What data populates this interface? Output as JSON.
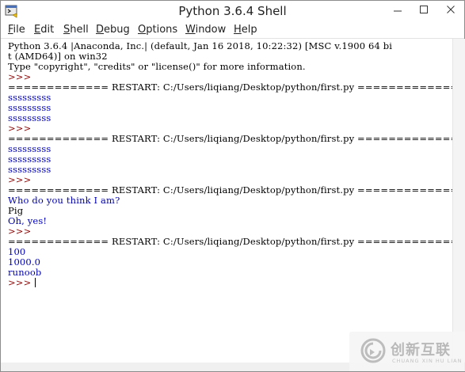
{
  "window": {
    "title": "Python 3.6.4 Shell"
  },
  "menu": [
    {
      "label": "File",
      "key": "F"
    },
    {
      "label": "Edit",
      "key": "E"
    },
    {
      "label": "Shell",
      "key": "S"
    },
    {
      "label": "Debug",
      "key": "D"
    },
    {
      "label": "Options",
      "key": "O"
    },
    {
      "label": "Window",
      "key": "W"
    },
    {
      "label": "Help",
      "key": "H"
    }
  ],
  "shell": {
    "lines": [
      "Python 3.6.4 |Anaconda, Inc.| (default, Jan 16 2018, 10:22:32) [MSC v.1900 64 bi",
      "t (AMD64)] on win32",
      "Type \"copyright\", \"credits\" or \"license()\" for more information.",
      ">>> ",
      "============= RESTART: C:/Users/liqiang/Desktop/python/first.py =============",
      "sssssssss",
      "sssssssss",
      "sssssssss",
      ">>> ",
      "============= RESTART: C:/Users/liqiang/Desktop/python/first.py =============",
      "sssssssss",
      "sssssssss",
      "sssssssss",
      ">>> ",
      "============= RESTART: C:/Users/liqiang/Desktop/python/first.py =============",
      "Who do you think I am?",
      "Pig",
      "Oh, yes!",
      ">>> ",
      "============= RESTART: C:/Users/liqiang/Desktop/python/first.py =============",
      "100",
      "1000.0",
      "runoob",
      ">>> "
    ]
  },
  "watermark": {
    "brand": "创新互联",
    "sub": "CHUANG XIN HU LIAN"
  },
  "colors": {
    "stdout": "#0000b4",
    "prompt": "#8b0000",
    "banner": "#000000",
    "input": "#000000"
  },
  "icons": {
    "app": "python-idle-icon",
    "minimize": "minimize-icon",
    "maximize": "maximize-icon",
    "close": "close-icon",
    "watermark": "chuangxin-logo-icon"
  }
}
